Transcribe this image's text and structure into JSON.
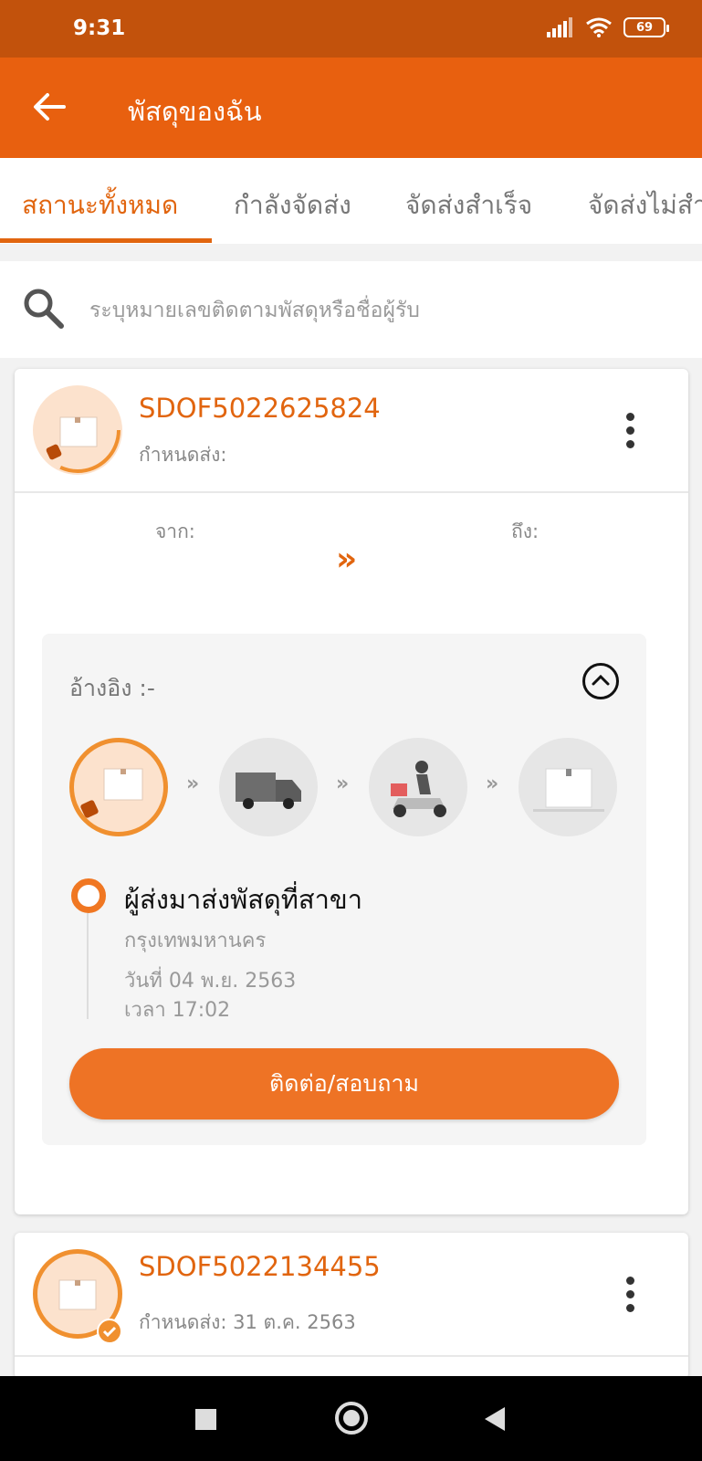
{
  "status_bar": {
    "time": "9:31",
    "battery": "69"
  },
  "app_bar": {
    "title": "พัสดุของฉัน"
  },
  "tabs": [
    {
      "label": "สถานะทั้งหมด",
      "active": true
    },
    {
      "label": "กำลังจัดส่ง",
      "active": false
    },
    {
      "label": "จัดส่งสำเร็จ",
      "active": false
    },
    {
      "label": "จัดส่งไม่สำ",
      "active": false
    }
  ],
  "search": {
    "placeholder": "ระบุหมายเลขติดตามพัสดุหรือชื่อผู้รับ"
  },
  "shipments": [
    {
      "tracking": "SDOF5022625824",
      "due_label": "กำหนดส่ง:",
      "from_label": "จาก:",
      "to_label": "ถึง:",
      "arrows": "»",
      "reference": "อ้างอิง :-",
      "steps_separator": "»",
      "event": {
        "title": "ผู้ส่งมาส่งพัสดุที่สาขา",
        "place": "กรุงเทพมหานคร",
        "date": "วันที่ 04 พ.ย. 2563",
        "time": "เวลา 17:02"
      },
      "contact_label": "ติดต่อ/สอบถาม"
    },
    {
      "tracking": "SDOF5022134455",
      "due_label": "กำหนดส่ง: 31 ต.ค. 2563"
    }
  ],
  "colors": {
    "brand": "#e8600f",
    "status_bar": "#c2520c",
    "accent_text": "#e1650f"
  }
}
